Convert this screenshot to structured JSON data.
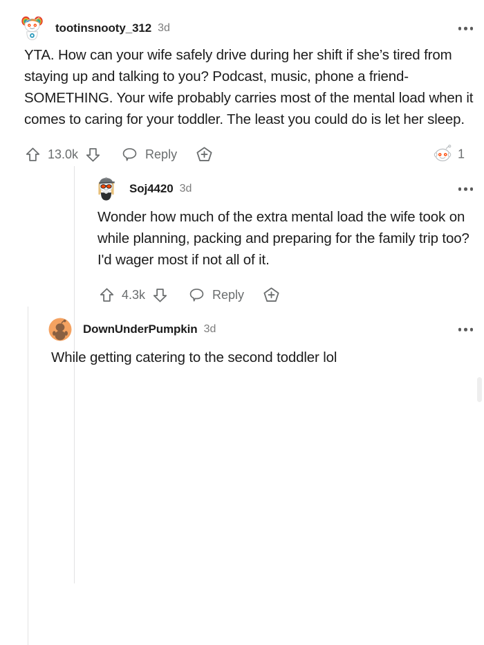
{
  "thread": {
    "comments": [
      {
        "author": "tootinsnooty_312",
        "timestamp": "3d",
        "body": "YTA. How can your wife safely drive during her shift if she’s tired from staying up and talking to you? Podcast, music, phone a friend- SOMETHING. Your wife probably carries most of the mental load when it comes to caring for your toddler. The least you could do is let her sleep.",
        "score": "13.0k",
        "reply_label": "Reply",
        "award_count": "1"
      },
      {
        "author": "Soj4420",
        "timestamp": "3d",
        "body": "Wonder how much of the extra mental load the wife took on while planning, packing and preparing for the family trip too? I'd wager most if not all of it.",
        "score": "4.3k",
        "reply_label": "Reply"
      },
      {
        "author": "DownUnderPumpkin",
        "timestamp": "3d",
        "body": "While getting catering to the second toddler lol"
      }
    ]
  },
  "colors": {
    "text": "#1c1c1c",
    "muted": "#6a6d6e",
    "timestamp": "#7c7c7c",
    "thread_line": "#e2e2e3",
    "avatar_orange": "#f4a261",
    "background": "#ffffff"
  }
}
